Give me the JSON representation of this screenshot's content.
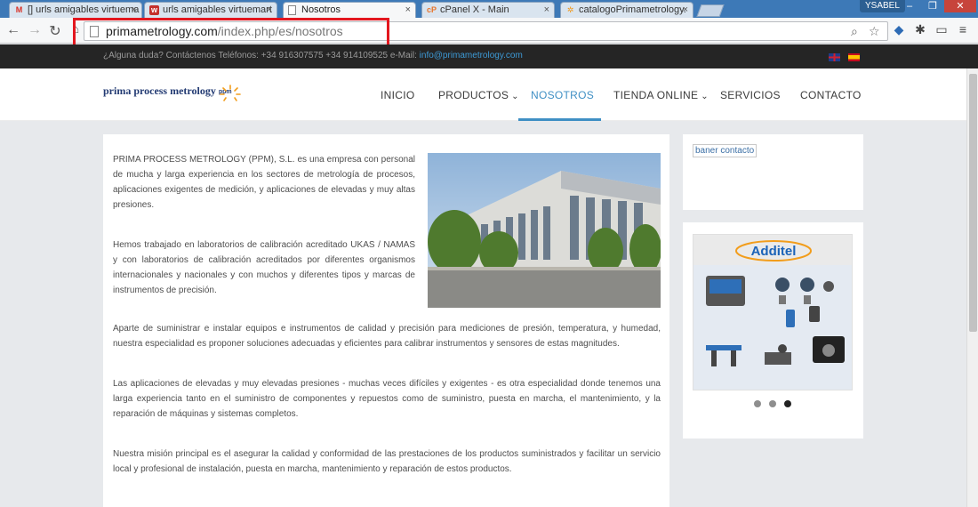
{
  "browser": {
    "tabs": [
      {
        "label": "[] urls amigables virtuema",
        "icon": "gmail-icon"
      },
      {
        "label": "urls amigables virtuemart",
        "icon": "w-icon"
      },
      {
        "label": "Nosotros",
        "icon": "page-icon"
      },
      {
        "label": "cPanel X - Main",
        "icon": "cpanel-icon"
      },
      {
        "label": "catalogoPrimametrology.",
        "icon": "joomla-icon"
      }
    ],
    "active_tab": 2,
    "user": "YSABEL",
    "window_controls": [
      "–",
      "❐",
      "✕"
    ],
    "url_host": "primametrology.com",
    "url_path": "/index.php/es/nosotros",
    "highlight_color": "#e3171f"
  },
  "topbar": {
    "contact_text": "¿Alguna duda? Contáctenos  Teléfonos: +34 916307575  +34 914109525  e-Mail: ",
    "email": "info@primametrology.com"
  },
  "header": {
    "logo_text": "prima process metrology",
    "logo_badge": "ppm",
    "menu": [
      {
        "label": "INICIO",
        "dropdown": false
      },
      {
        "label": "PRODUCTOS",
        "dropdown": true
      },
      {
        "label": "NOSOTROS",
        "dropdown": false,
        "active": true
      },
      {
        "label": "TIENDA ONLINE",
        "dropdown": true
      },
      {
        "label": "SERVICIOS",
        "dropdown": false
      },
      {
        "label": "CONTACTO",
        "dropdown": false
      }
    ],
    "accent_color": "#3f8fc4"
  },
  "content": {
    "paragraphs": [
      "PRIMA PROCESS METROLOGY (PPM), S.L. es una empresa con personal de mucha y larga experiencia en los sectores de metrología de procesos, aplicaciones exigentes de medición, y aplicaciones de elevadas y muy altas presiones.",
      "Hemos trabajado en laboratorios de calibración acreditado UKAS / NAMAS y con laboratorios de calibración acreditados por diferentes organismos internacionales y nacionales y con muchos y diferentes tipos y marcas de instrumentos de precisión.",
      "Aparte de suministrar e instalar equipos e instrumentos de calidad y precisión para mediciones de presión, temperatura, y humedad, nuestra especialidad es proponer soluciones adecuadas y eficientes para calibrar instrumentos y sensores de estas magnitudes.",
      "Las aplicaciones de elevadas y muy elevadas presiones - muchas veces difíciles y exigentes - es otra especialidad donde tenemos una larga experiencia tanto en el suministro de componentes y repuestos como de suministro, puesta en marcha, el mantenimiento, y la reparación de máquinas y sistemas completos.",
      "Nuestra misión principal es el asegurar la calidad y conformidad de las prestaciones de los productos suministrados y facilitar un servicio local y profesional de instalación, puesta en marcha, mantenimiento y reparación de estos productos."
    ]
  },
  "sidebar": {
    "banner_alt": "baner contacto",
    "slider_brand": "Additel",
    "slider_dots": 3,
    "slider_active_dot": 2
  }
}
